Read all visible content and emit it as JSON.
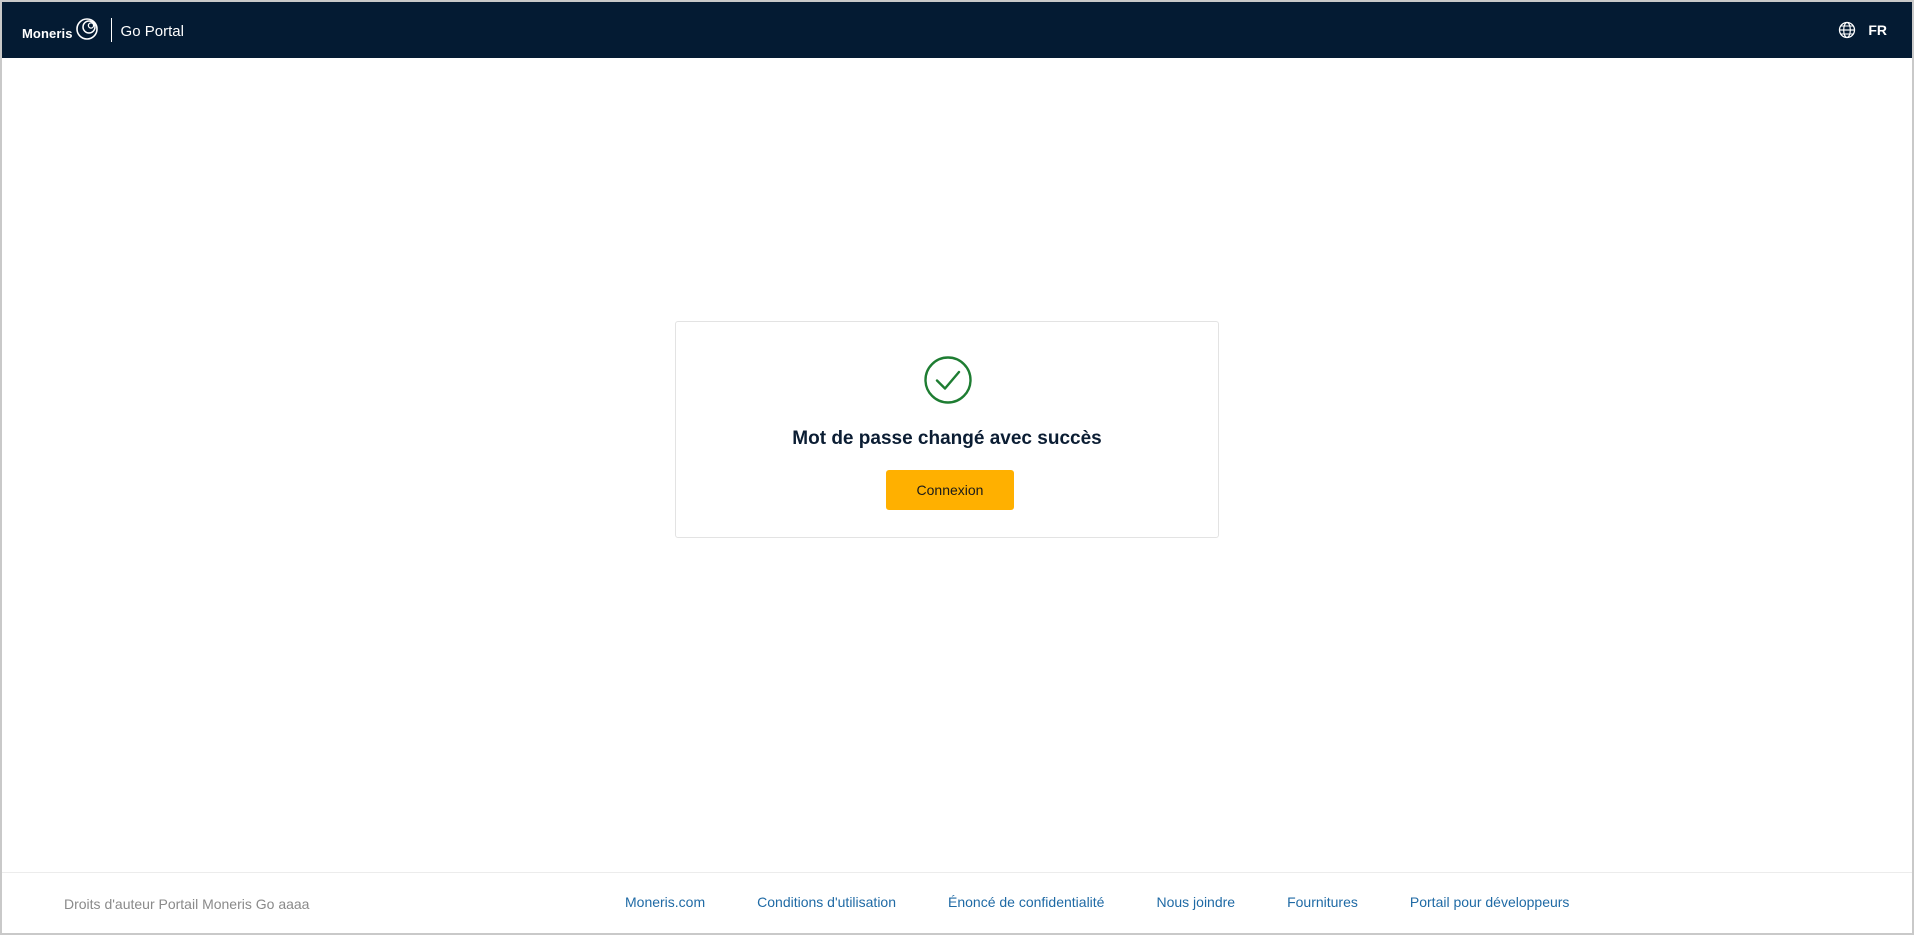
{
  "header": {
    "brand_name": "Moneris",
    "product_name": "Go Portal",
    "language_label": "FR"
  },
  "card": {
    "title": "Mot de passe changé avec succès",
    "button_label": "Connexion"
  },
  "footer": {
    "copyright": "Droits d'auteur Portail Moneris Go  aaaa",
    "links": [
      "Moneris.com",
      "Conditions d'utilisation",
      "Énoncé de confidentialité",
      "Nous joindre",
      "Fournitures",
      "Portail pour développeurs"
    ]
  },
  "colors": {
    "header_bg": "#041b33",
    "button_bg": "#ffb000",
    "success_green": "#1e7d32",
    "link": "#1f6aa5"
  },
  "icons": {
    "logo": "moneris-swirl-icon",
    "language": "globe-icon",
    "success": "check-circle-icon"
  }
}
